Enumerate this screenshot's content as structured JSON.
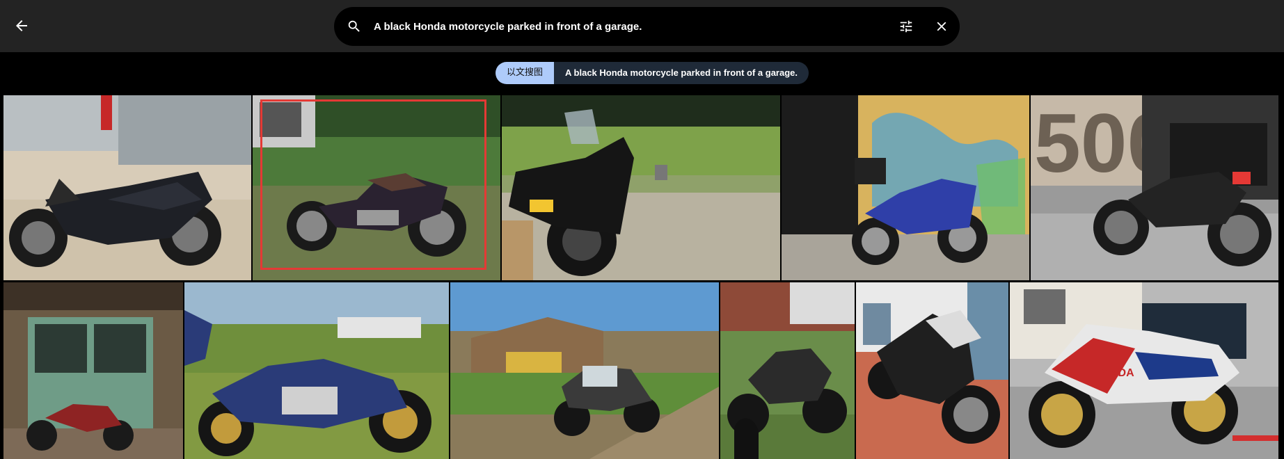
{
  "search": {
    "query": "A black Honda motorcycle parked in front of a garage.",
    "back_icon": "arrow-left-icon",
    "search_icon": "search-icon",
    "tune_icon": "tune-icon",
    "close_icon": "close-icon"
  },
  "chips": {
    "mode_label": "以文搜图",
    "query_label": "A black Honda motorcycle parked in front of a garage."
  },
  "results": {
    "selected_index": 1,
    "tiles": [
      {
        "subject": "black adventure motorcycle on gravel"
      },
      {
        "subject": "vintage cruiser on grass"
      },
      {
        "subject": "motorcycle with luggage on hill"
      },
      {
        "subject": "blue motorcycle by graffiti wall"
      },
      {
        "subject": "cafe racer near 500 sign"
      },
      {
        "subject": "red bike by green garage door"
      },
      {
        "subject": "blue cruiser on grass"
      },
      {
        "subject": "touring bike by farm buildings"
      },
      {
        "subject": "cruiser with black cat"
      },
      {
        "subject": "black sport bike on brick road"
      },
      {
        "subject": "red white Honda race bike",
        "logo_text": "HONDA"
      }
    ]
  }
}
